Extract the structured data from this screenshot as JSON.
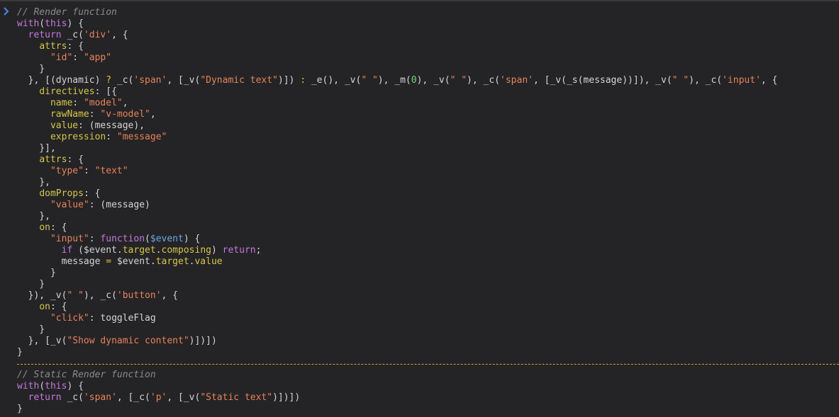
{
  "console": {
    "prompt_icon": "chevron-right-icon",
    "colors": {
      "background": "#242426",
      "comment": "#8a8a8a",
      "keyword": "#c678dd",
      "property": "#d6c54b",
      "string": "#e8825a",
      "number": "#7ccf7c",
      "variable": "#6aa7e8",
      "operator": "#e8bd4f",
      "text": "#d5d5d5",
      "prompt": "#4a8be8",
      "separator": "#c7a43f"
    },
    "lines": [
      [
        {
          "t": "comment",
          "v": "// Render function"
        }
      ],
      [
        {
          "t": "kw",
          "v": "with"
        },
        {
          "t": "plain",
          "v": "("
        },
        {
          "t": "kw",
          "v": "this"
        },
        {
          "t": "plain",
          "v": ") {"
        }
      ],
      [
        {
          "t": "plain",
          "v": "  "
        },
        {
          "t": "kw",
          "v": "return"
        },
        {
          "t": "plain",
          "v": " _c("
        },
        {
          "t": "str",
          "v": "'div'"
        },
        {
          "t": "plain",
          "v": ", {"
        }
      ],
      [
        {
          "t": "plain",
          "v": "    "
        },
        {
          "t": "prop",
          "v": "attrs"
        },
        {
          "t": "plain",
          "v": ": {"
        }
      ],
      [
        {
          "t": "plain",
          "v": "      "
        },
        {
          "t": "str",
          "v": "\"id\""
        },
        {
          "t": "plain",
          "v": ": "
        },
        {
          "t": "str",
          "v": "\"app\""
        }
      ],
      [
        {
          "t": "plain",
          "v": "    }"
        }
      ],
      [
        {
          "t": "plain",
          "v": "  }, [(dynamic) "
        },
        {
          "t": "op",
          "v": "?"
        },
        {
          "t": "plain",
          "v": " _c("
        },
        {
          "t": "str",
          "v": "'span'"
        },
        {
          "t": "plain",
          "v": ", [_v("
        },
        {
          "t": "str",
          "v": "\"Dynamic text\""
        },
        {
          "t": "plain",
          "v": ")]) "
        },
        {
          "t": "op",
          "v": ":"
        },
        {
          "t": "plain",
          "v": " _e(), _v("
        },
        {
          "t": "str",
          "v": "\" \""
        },
        {
          "t": "plain",
          "v": "), _m("
        },
        {
          "t": "num",
          "v": "0"
        },
        {
          "t": "plain",
          "v": "), _v("
        },
        {
          "t": "str",
          "v": "\" \""
        },
        {
          "t": "plain",
          "v": "), _c("
        },
        {
          "t": "str",
          "v": "'span'"
        },
        {
          "t": "plain",
          "v": ", [_v(_s(message))]), _v("
        },
        {
          "t": "str",
          "v": "\" \""
        },
        {
          "t": "plain",
          "v": "), _c("
        },
        {
          "t": "str",
          "v": "'input'"
        },
        {
          "t": "plain",
          "v": ", {"
        }
      ],
      [
        {
          "t": "plain",
          "v": "    "
        },
        {
          "t": "prop",
          "v": "directives"
        },
        {
          "t": "plain",
          "v": ": [{"
        }
      ],
      [
        {
          "t": "plain",
          "v": "      "
        },
        {
          "t": "prop",
          "v": "name"
        },
        {
          "t": "plain",
          "v": ": "
        },
        {
          "t": "str",
          "v": "\"model\""
        },
        {
          "t": "plain",
          "v": ","
        }
      ],
      [
        {
          "t": "plain",
          "v": "      "
        },
        {
          "t": "prop",
          "v": "rawName"
        },
        {
          "t": "plain",
          "v": ": "
        },
        {
          "t": "str",
          "v": "\"v-model\""
        },
        {
          "t": "plain",
          "v": ","
        }
      ],
      [
        {
          "t": "plain",
          "v": "      "
        },
        {
          "t": "prop",
          "v": "value"
        },
        {
          "t": "plain",
          "v": ": (message),"
        }
      ],
      [
        {
          "t": "plain",
          "v": "      "
        },
        {
          "t": "prop",
          "v": "expression"
        },
        {
          "t": "plain",
          "v": ": "
        },
        {
          "t": "str",
          "v": "\"message\""
        }
      ],
      [
        {
          "t": "plain",
          "v": "    }],"
        }
      ],
      [
        {
          "t": "plain",
          "v": "    "
        },
        {
          "t": "prop",
          "v": "attrs"
        },
        {
          "t": "plain",
          "v": ": {"
        }
      ],
      [
        {
          "t": "plain",
          "v": "      "
        },
        {
          "t": "str",
          "v": "\"type\""
        },
        {
          "t": "plain",
          "v": ": "
        },
        {
          "t": "str",
          "v": "\"text\""
        }
      ],
      [
        {
          "t": "plain",
          "v": "    },"
        }
      ],
      [
        {
          "t": "plain",
          "v": "    "
        },
        {
          "t": "prop",
          "v": "domProps"
        },
        {
          "t": "plain",
          "v": ": {"
        }
      ],
      [
        {
          "t": "plain",
          "v": "      "
        },
        {
          "t": "str",
          "v": "\"value\""
        },
        {
          "t": "plain",
          "v": ": (message)"
        }
      ],
      [
        {
          "t": "plain",
          "v": "    },"
        }
      ],
      [
        {
          "t": "plain",
          "v": "    "
        },
        {
          "t": "prop",
          "v": "on"
        },
        {
          "t": "plain",
          "v": ": {"
        }
      ],
      [
        {
          "t": "plain",
          "v": "      "
        },
        {
          "t": "str",
          "v": "\"input\""
        },
        {
          "t": "plain",
          "v": ": "
        },
        {
          "t": "kw",
          "v": "function"
        },
        {
          "t": "plain",
          "v": "("
        },
        {
          "t": "var",
          "v": "$event"
        },
        {
          "t": "plain",
          "v": ") {"
        }
      ],
      [
        {
          "t": "plain",
          "v": "        "
        },
        {
          "t": "kw",
          "v": "if"
        },
        {
          "t": "plain",
          "v": " ($event."
        },
        {
          "t": "prop",
          "v": "target"
        },
        {
          "t": "plain",
          "v": "."
        },
        {
          "t": "prop",
          "v": "composing"
        },
        {
          "t": "plain",
          "v": ") "
        },
        {
          "t": "kw",
          "v": "return"
        },
        {
          "t": "plain",
          "v": ";"
        }
      ],
      [
        {
          "t": "plain",
          "v": "        message "
        },
        {
          "t": "op",
          "v": "="
        },
        {
          "t": "plain",
          "v": " $event."
        },
        {
          "t": "prop",
          "v": "target"
        },
        {
          "t": "plain",
          "v": "."
        },
        {
          "t": "prop",
          "v": "value"
        }
      ],
      [
        {
          "t": "plain",
          "v": "      }"
        }
      ],
      [
        {
          "t": "plain",
          "v": "    }"
        }
      ],
      [
        {
          "t": "plain",
          "v": "  }), _v("
        },
        {
          "t": "str",
          "v": "\" \""
        },
        {
          "t": "plain",
          "v": "), _c("
        },
        {
          "t": "str",
          "v": "'button'"
        },
        {
          "t": "plain",
          "v": ", {"
        }
      ],
      [
        {
          "t": "plain",
          "v": "    "
        },
        {
          "t": "prop",
          "v": "on"
        },
        {
          "t": "plain",
          "v": ": {"
        }
      ],
      [
        {
          "t": "plain",
          "v": "      "
        },
        {
          "t": "str",
          "v": "\"click\""
        },
        {
          "t": "plain",
          "v": ": toggleFlag"
        }
      ],
      [
        {
          "t": "plain",
          "v": "    }"
        }
      ],
      [
        {
          "t": "plain",
          "v": "  }, [_v("
        },
        {
          "t": "str",
          "v": "\"Show dynamic content\""
        },
        {
          "t": "plain",
          "v": ")])])"
        }
      ],
      [
        {
          "t": "plain",
          "v": "}"
        }
      ],
      "separator",
      [
        {
          "t": "comment",
          "v": "// Static Render function"
        }
      ],
      [
        {
          "t": "kw",
          "v": "with"
        },
        {
          "t": "plain",
          "v": "("
        },
        {
          "t": "kw",
          "v": "this"
        },
        {
          "t": "plain",
          "v": ") {"
        }
      ],
      [
        {
          "t": "plain",
          "v": "  "
        },
        {
          "t": "kw",
          "v": "return"
        },
        {
          "t": "plain",
          "v": " _c("
        },
        {
          "t": "str",
          "v": "'span'"
        },
        {
          "t": "plain",
          "v": ", [_c("
        },
        {
          "t": "str",
          "v": "'p'"
        },
        {
          "t": "plain",
          "v": ", [_v("
        },
        {
          "t": "str",
          "v": "\"Static text\""
        },
        {
          "t": "plain",
          "v": ")])])"
        }
      ],
      [
        {
          "t": "plain",
          "v": "}"
        }
      ]
    ]
  }
}
